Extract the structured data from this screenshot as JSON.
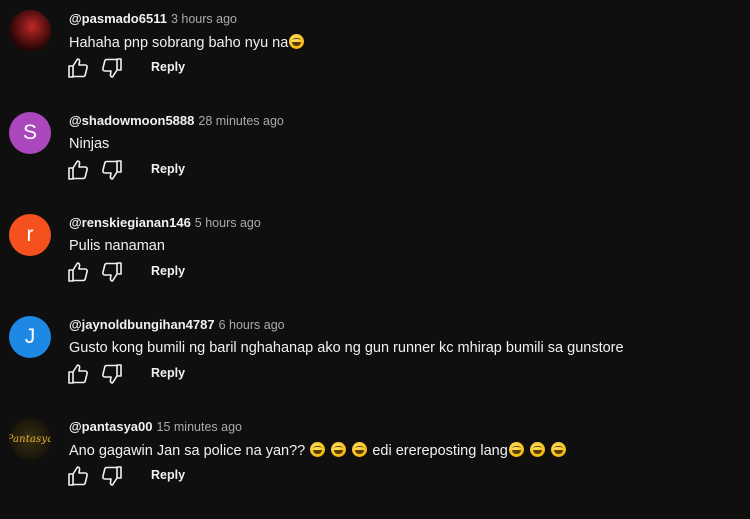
{
  "comments": [
    {
      "author": "@pasmado6511",
      "time": "3 hours ago",
      "text": "Hahaha pnp sobrang baho nyu na",
      "emoji_count": 1,
      "avatar": {
        "letter": "",
        "color": "#7a1515"
      },
      "reply_label": "Reply"
    },
    {
      "author": "@shadowmoon5888",
      "time": "28 minutes ago",
      "text": "Ninjas",
      "emoji_count": 0,
      "avatar": {
        "letter": "S",
        "color": "#ab47bc"
      },
      "reply_label": "Reply"
    },
    {
      "author": "@renskiegianan146",
      "time": "5 hours ago",
      "text": "Pulis nanaman",
      "emoji_count": 0,
      "avatar": {
        "letter": "r",
        "color": "#f4511e"
      },
      "reply_label": "Reply"
    },
    {
      "author": "@jaynoldbungihan4787",
      "time": "6 hours ago",
      "text": "Gusto kong bumili ng baril nghahanap ako ng gun runner kc mhirap bumili sa gunstore",
      "emoji_count": 0,
      "avatar": {
        "letter": "J",
        "color": "#1e88e5"
      },
      "reply_label": "Reply"
    },
    {
      "author": "@pantasya00",
      "time": "15 minutes ago",
      "text_part1": "Ano gagawin Jan sa police na yan??",
      "text_part2": "edi erereposting lang",
      "avatar": {
        "letter": "Pantasya",
        "color": "#201a0c"
      },
      "reply_label": "Reply"
    }
  ],
  "icons": {
    "like": "thumbs-up-icon",
    "dislike": "thumbs-down-icon",
    "emoji": "grinning-face-emoji"
  },
  "colors": {
    "background": "#0f0f0f",
    "text": "#f1f1f1",
    "secondary_text": "#aaaaaa"
  }
}
